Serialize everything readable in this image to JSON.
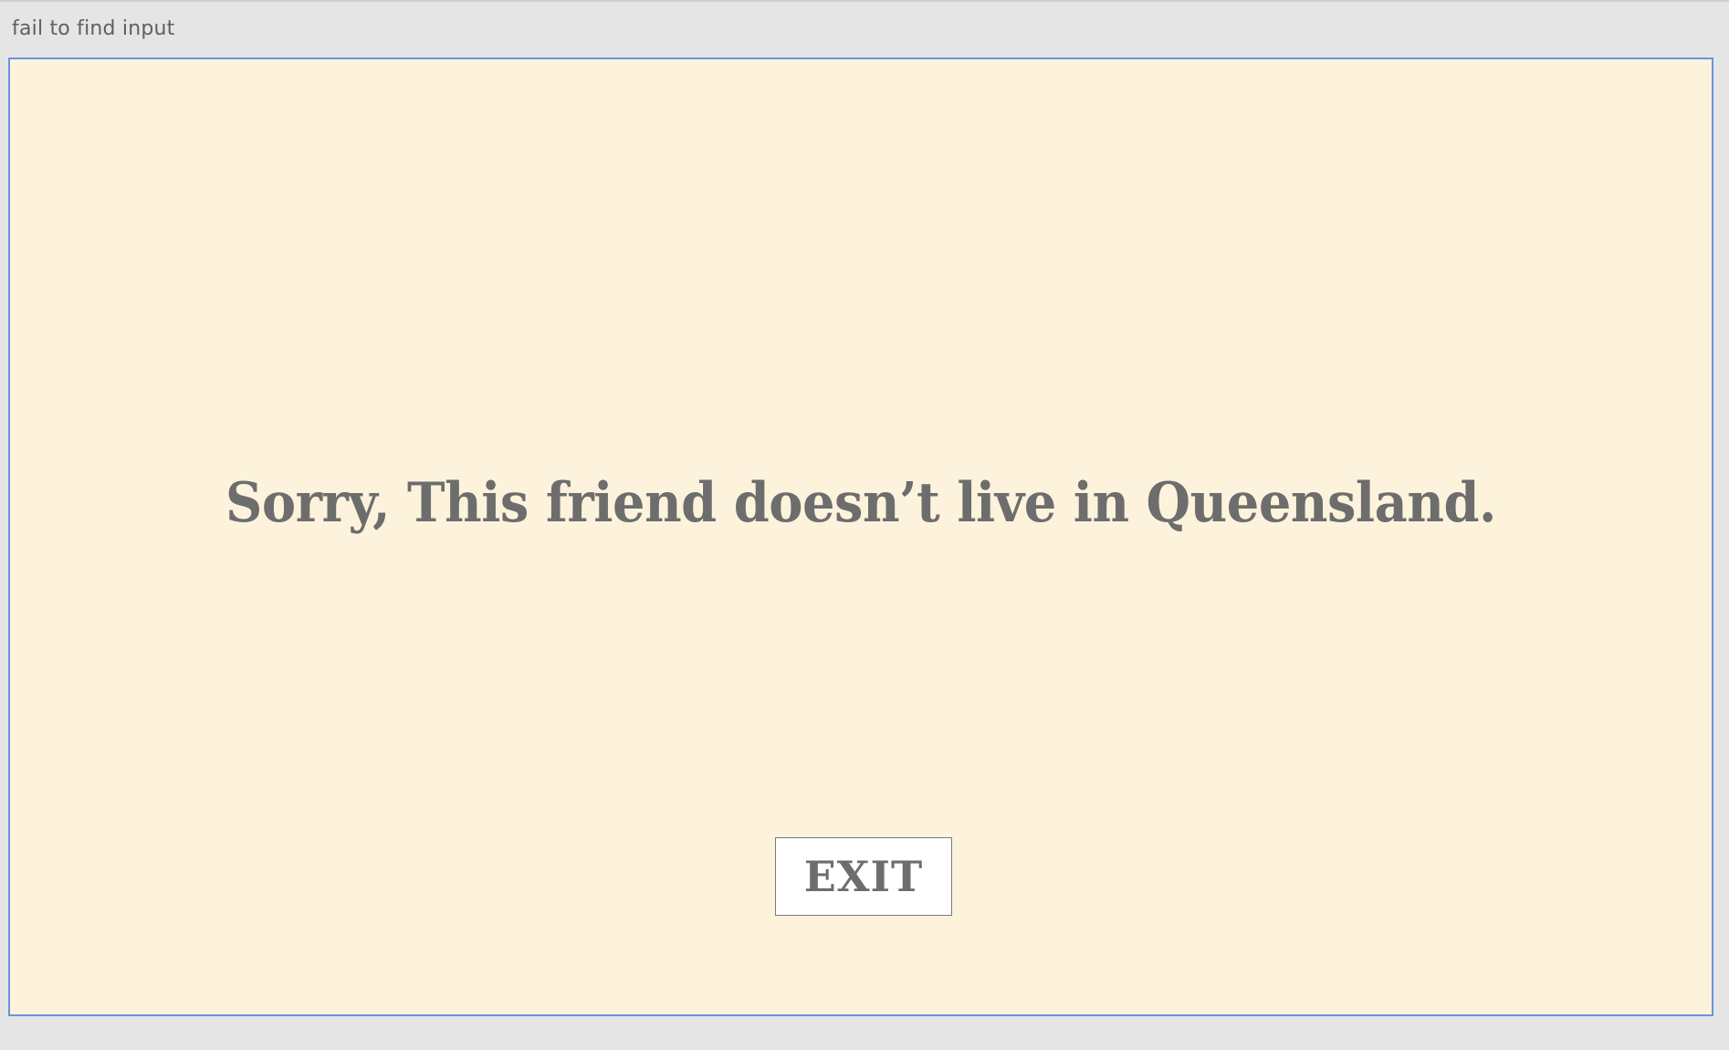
{
  "status": {
    "text": "fail to find input"
  },
  "game": {
    "background_color": "#fdf3dd",
    "frame_border_color": "#6b93da",
    "message": "Sorry, This friend doesn’t live in Queensland.",
    "exit_label": "EXIT",
    "text_color": "#6d6d6d"
  }
}
